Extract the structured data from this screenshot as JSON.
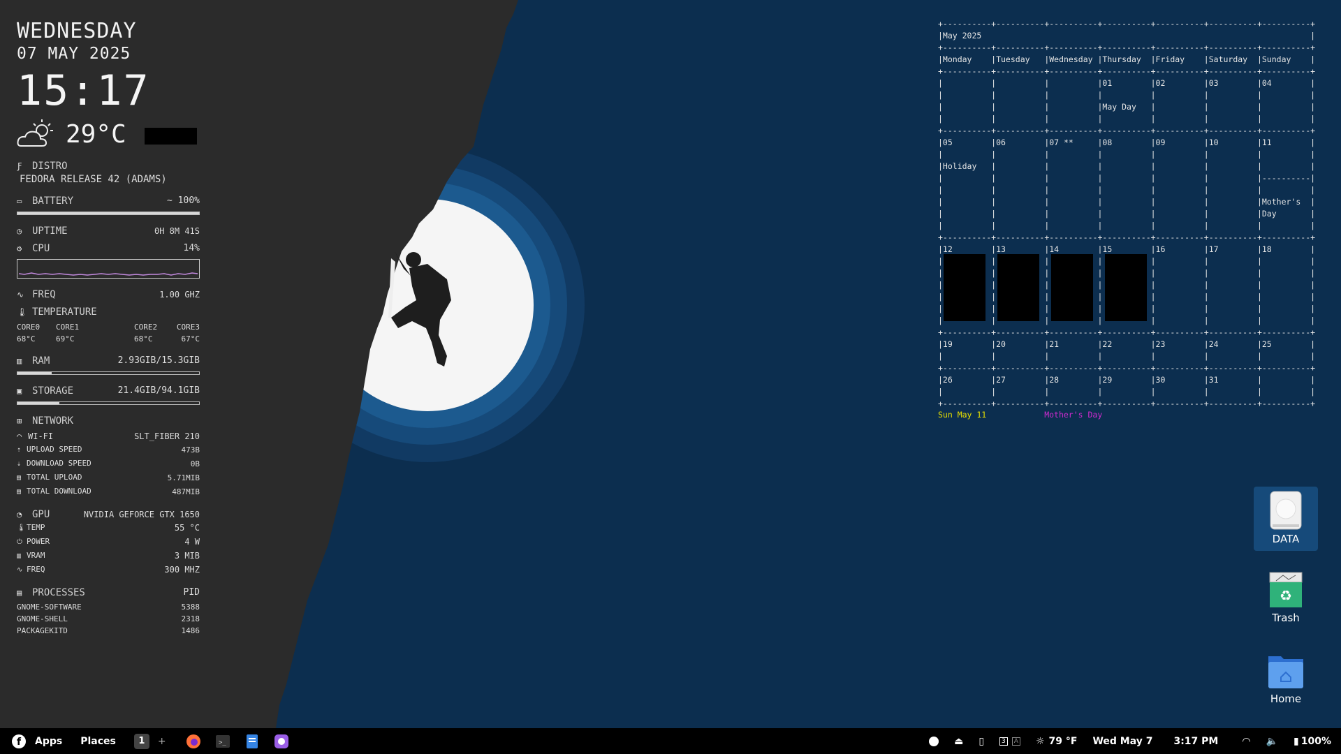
{
  "conky": {
    "day": "WEDNESDAY",
    "date": "07 MAY 2025",
    "time": "15:17",
    "temperature": "29°C",
    "distro_label": "DISTRO",
    "distro_value": "FEDORA RELEASE 42 (ADAMS)",
    "battery_label": "BATTERY",
    "battery_value": "~ 100%",
    "battery_level": 1.0,
    "uptime_label": "UPTIME",
    "uptime_value": "0H 8M 41S",
    "cpu_label": "CPU",
    "cpu_value": "14%",
    "freq_label": "FREQ",
    "freq_value": "1.00 GHZ",
    "temp_label": "TEMPERATURE",
    "cores": [
      {
        "name": "CORE0",
        "value": "68°C"
      },
      {
        "name": "CORE1",
        "value": "69°C"
      },
      {
        "name": "CORE2",
        "value": "68°C"
      },
      {
        "name": "CORE3",
        "value": "67°C"
      }
    ],
    "ram_label": "RAM",
    "ram_value": "2.93GIB/15.3GIB",
    "ram_level": 0.19,
    "storage_label": "STORAGE",
    "storage_value": "21.4GIB/94.1GIB",
    "storage_level": 0.23,
    "network_label": "NETWORK",
    "wifi_label": "WI-FI",
    "wifi_value": "SLT_FIBER 210",
    "upload_label": "UPLOAD SPEED",
    "upload_value": "473B",
    "download_label": "DOWNLOAD SPEED",
    "download_value": "0B",
    "total_upload_label": "TOTAL UPLOAD",
    "total_upload_value": "5.71MIB",
    "total_download_label": "TOTAL DOWNLOAD",
    "total_download_value": "487MIB",
    "gpu_label": "GPU",
    "gpu_value": "NVIDIA GEFORCE GTX 1650",
    "gpu_temp_label": "TEMP",
    "gpu_temp_value": "55 °C",
    "gpu_power_label": "POWER",
    "gpu_power_value": "4 W",
    "gpu_vram_label": "VRAM",
    "gpu_vram_value": "3 MIB",
    "gpu_freq_label": "FREQ",
    "gpu_freq_value": "300 MHZ",
    "processes_label": "PROCESSES",
    "pid_label": "PID",
    "processes": [
      {
        "name": "GNOME-SOFTWARE",
        "pid": "5388"
      },
      {
        "name": "GNOME-SHELL",
        "pid": "2318"
      },
      {
        "name": "PACKAGEKITD",
        "pid": "1486"
      }
    ]
  },
  "calendar": {
    "title": "May 2025",
    "weekdays": [
      "Monday",
      "Tuesday",
      "Wednesday",
      "Thursday",
      "Friday",
      "Saturday",
      "Sunday"
    ],
    "weeks": [
      [
        "",
        "",
        "",
        "01",
        "02",
        "03",
        "04"
      ],
      [
        "05",
        "06",
        "07 **",
        "08",
        "09",
        "10",
        "11"
      ],
      [
        "12",
        "13",
        "14",
        "15",
        "16",
        "17",
        "18"
      ],
      [
        "19",
        "20",
        "21",
        "22",
        "23",
        "24",
        "25"
      ],
      [
        "26",
        "27",
        "28",
        "29",
        "30",
        "31",
        ""
      ]
    ],
    "events": {
      "may_day": "May Day",
      "holiday": "Holiday",
      "mothers_day_1": "Mother's",
      "mothers_day_2": "Day"
    },
    "footer_date": "Sun May 11",
    "footer_event": "Mother's Day",
    "footer_date_color": "#e8e000",
    "footer_event_color": "#d02bd0"
  },
  "desktop_icons": [
    {
      "label": "DATA",
      "icon": "drive-icon"
    },
    {
      "label": "Trash",
      "icon": "trash-icon"
    },
    {
      "label": "Home",
      "icon": "home-folder-icon"
    }
  ],
  "taskbar": {
    "apps_label": "Apps",
    "places_label": "Places",
    "workspace": "1",
    "add_workspace": "+",
    "weather": "79 °F",
    "date": "Wed May 7",
    "time": "3:17 PM",
    "battery": "100%"
  },
  "colors": {
    "sky": "#0c2e4f",
    "cliff": "#2b2b2b",
    "moon": "#f5f5f5",
    "ring": "#1c5a8f"
  }
}
